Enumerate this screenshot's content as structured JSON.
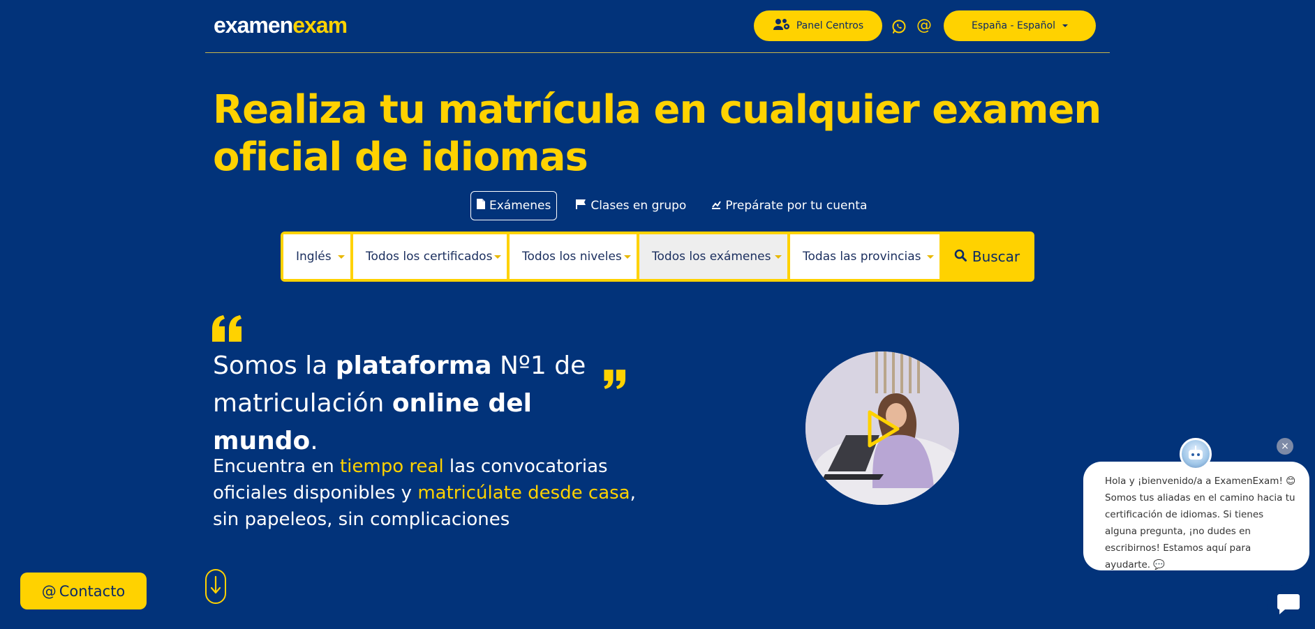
{
  "header": {
    "logo_part1": "examen",
    "logo_part2": "exam",
    "panel_label": "Panel Centros",
    "lang_label": "España - Español",
    "at_symbol": "@"
  },
  "hero": {
    "title": "Realiza tu matrícula en cualquier examen oficial de idiomas"
  },
  "tabs": [
    {
      "label": "Exámenes",
      "icon": "document-icon"
    },
    {
      "label": "Clases en grupo",
      "icon": "flag-icon"
    },
    {
      "label": "Prepárate por tu cuenta",
      "icon": "chart-icon"
    }
  ],
  "search": {
    "language": "Inglés",
    "certificate": "Todos los certificados",
    "level": "Todos los niveles",
    "exam": "Todos los exámenes",
    "province": "Todas las provincias",
    "button": "Buscar"
  },
  "quote": {
    "p1": "Somos la ",
    "b1": "plataforma",
    "p2": " Nº1 de matriculación ",
    "b2": "online del mundo",
    "p3": "."
  },
  "sub": {
    "t1": "Encuentra en ",
    "y1": "tiempo real",
    "t2": " las convocatorias oficiales disponibles y ",
    "y2": "matricúlate desde casa",
    "t3": ", sin papeleos, sin complicaciones"
  },
  "contact": {
    "label": "Contacto",
    "symbol": "@"
  },
  "chat": {
    "message": "Hola y ¡bienvenido/a a ExamenExam! 😊 Somos tus aliadas en el camino hacia tu certificación de idiomas. Si tienes alguna pregunta, ¡no dudes en escribirnos! Estamos aquí para ayudarte. 💬",
    "close": "×"
  },
  "colors": {
    "bg": "#02337a",
    "accent": "#ffd200"
  }
}
